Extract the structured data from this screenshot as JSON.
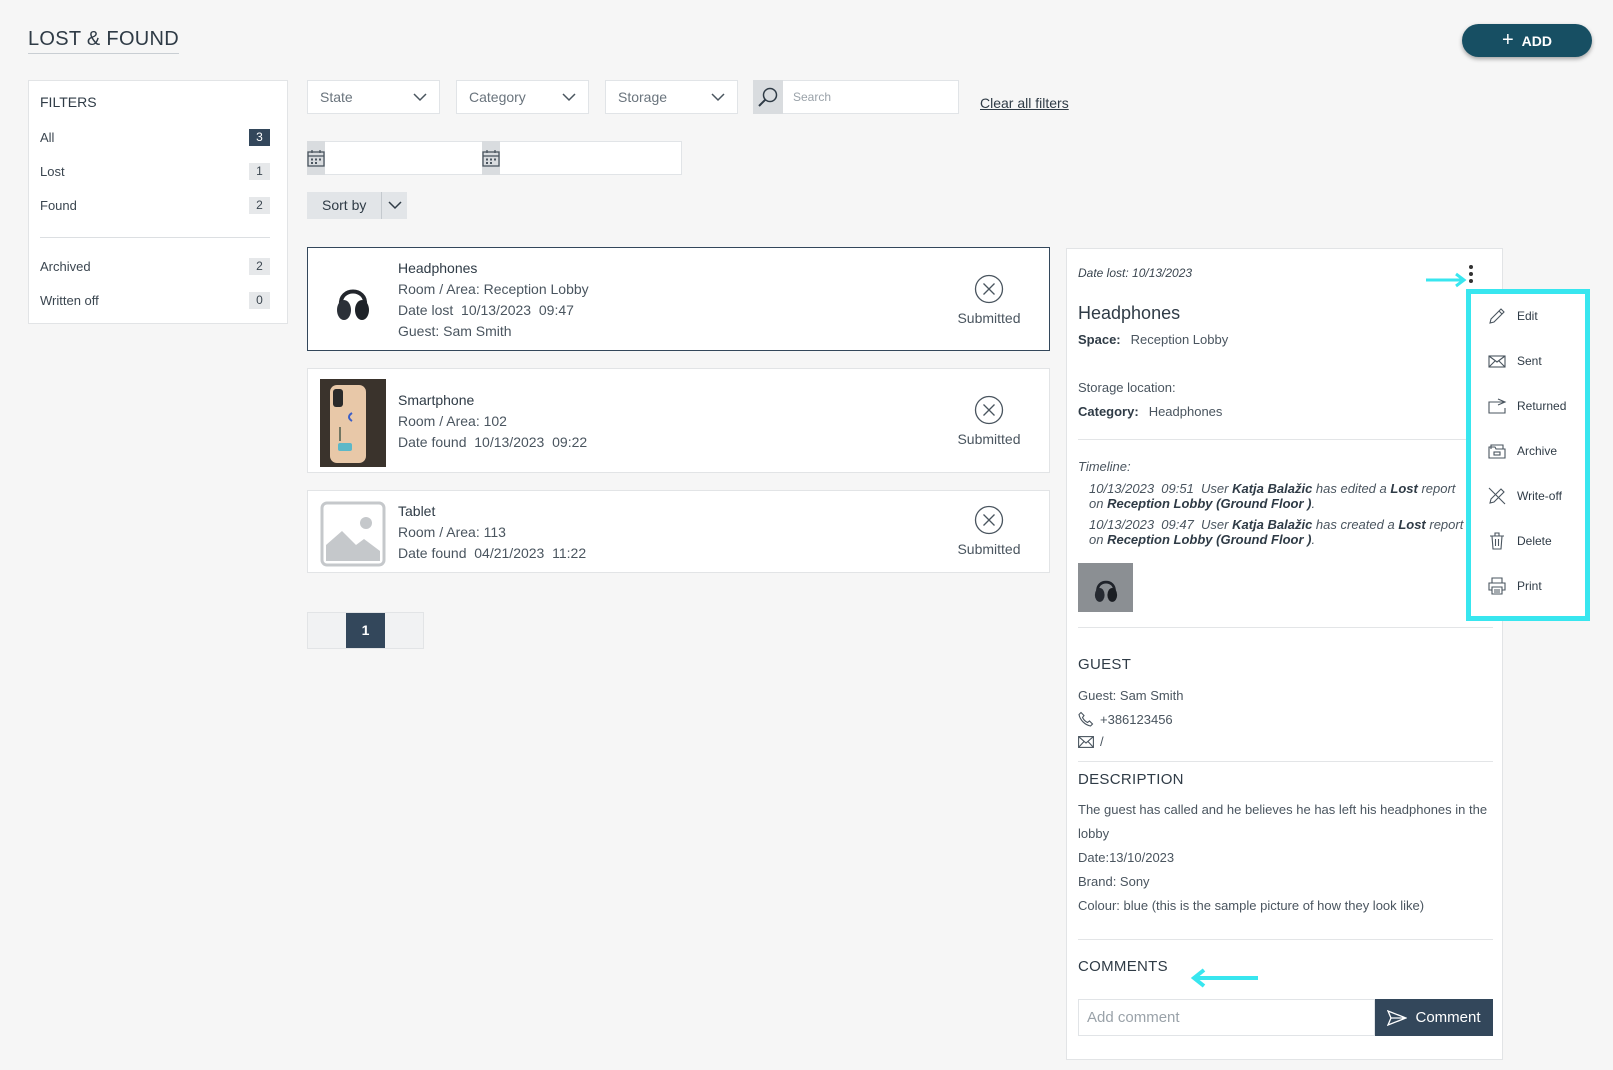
{
  "header": {
    "title": "LOST & FOUND",
    "add_label": "ADD"
  },
  "filters": {
    "title": "FILTERS",
    "items": [
      {
        "label": "All",
        "count": "3"
      },
      {
        "label": "Lost",
        "count": "1"
      },
      {
        "label": "Found",
        "count": "2"
      },
      {
        "label": "Archived",
        "count": "2"
      },
      {
        "label": "Written off",
        "count": "0"
      }
    ]
  },
  "toolbar": {
    "state": "State",
    "category": "Category",
    "storage": "Storage",
    "search_placeholder": "Search",
    "clear_all": "Clear all filters",
    "sort_by": "Sort by"
  },
  "items": [
    {
      "name": "Headphones",
      "line1": "Room / Area: Reception Lobby",
      "line2": "Date lost  10/13/2023  09:47",
      "line3": "Guest: Sam Smith",
      "status": "Submitted"
    },
    {
      "name": "Smartphone",
      "line1": "Room / Area: 102",
      "line2": "Date found  10/13/2023  09:22",
      "status": "Submitted"
    },
    {
      "name": "Tablet",
      "line1": "Room / Area: 113",
      "line2": "Date found  04/21/2023  11:22",
      "status": "Submitted"
    }
  ],
  "pagination": {
    "current": "1"
  },
  "detail": {
    "date_lost": "Date lost: 10/13/2023",
    "name": "Headphones",
    "space_label": "Space:",
    "space_value": "Reception Lobby",
    "storage_label": "Storage location:",
    "category_label": "Category:",
    "category_value": "Headphones",
    "timeline_title": "Timeline:",
    "timeline": [
      {
        "time": "10/13/2023  09:51  User ",
        "user": "Katja Balažic",
        "mid": " has edited a ",
        "type": "Lost",
        "mid2": " report on ",
        "place": "Reception Lobby (Ground Floor )",
        "end": "."
      },
      {
        "time": "10/13/2023  09:47  User ",
        "user": "Katja Balažic",
        "mid": " has created a ",
        "type": "Lost",
        "mid2": " report on ",
        "place": "Reception Lobby (Ground Floor )",
        "end": "."
      }
    ],
    "guest_section": "GUEST",
    "guest_name": "Guest: Sam Smith",
    "guest_phone": "+386123456",
    "guest_email": "/",
    "description_section": "DESCRIPTION",
    "description": [
      "The guest has called and he believes he has left his headphones in the lobby",
      "Date:13/10/2023",
      "Brand: Sony",
      "Colour: blue (this is the sample picture of how they look like)"
    ],
    "comments_section": "COMMENTS",
    "comment_placeholder": "Add comment",
    "comment_button": "Comment"
  },
  "menu": {
    "items": [
      {
        "label": "Edit",
        "icon": "pencil-icon"
      },
      {
        "label": "Sent",
        "icon": "envelope-icon"
      },
      {
        "label": "Returned",
        "icon": "return-icon"
      },
      {
        "label": "Archive",
        "icon": "archive-icon"
      },
      {
        "label": "Write-off",
        "icon": "write-off-icon"
      },
      {
        "label": "Delete",
        "icon": "trash-icon"
      },
      {
        "label": "Print",
        "icon": "printer-icon"
      }
    ]
  },
  "colors": {
    "primary": "#174f63",
    "dark": "#33475b",
    "highlight": "#38e6ef"
  }
}
